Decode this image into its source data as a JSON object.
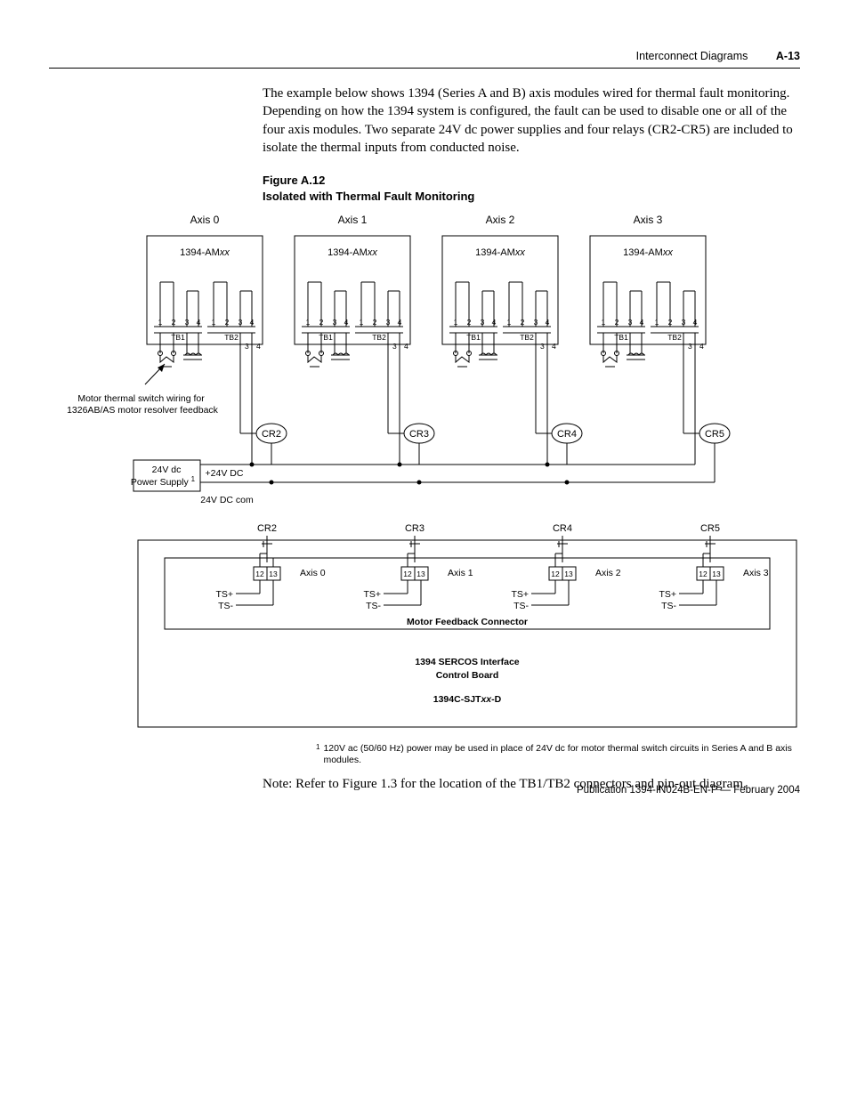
{
  "header": {
    "section": "Interconnect Diagrams",
    "pageno": "A-13"
  },
  "intro": "The example below shows 1394 (Series A and B) axis modules wired for thermal fault monitoring. Depending on how the 1394 system is configured, the fault can be used to disable one or all of the four axis modules. Two separate 24V dc power supplies and four relays (CR2-CR5) are included to isolate the thermal inputs from conducted noise.",
  "figure": {
    "num": "Figure A.12",
    "title": "Isolated with Thermal Fault Monitoring"
  },
  "diagram": {
    "axes": [
      {
        "label": "Axis 0",
        "module": "1394-AM",
        "mod_suffix": "xx",
        "relay_top": "CR2",
        "relay_bot": "CR2",
        "feedback_axis": "Axis 0"
      },
      {
        "label": "Axis 1",
        "module": "1394-AM",
        "mod_suffix": "xx",
        "relay_top": "CR3",
        "relay_bot": "CR3",
        "feedback_axis": "Axis 1"
      },
      {
        "label": "Axis 2",
        "module": "1394-AM",
        "mod_suffix": "xx",
        "relay_top": "CR4",
        "relay_bot": "CR4",
        "feedback_axis": "Axis 2"
      },
      {
        "label": "Axis 3",
        "module": "1394-AM",
        "mod_suffix": "xx",
        "relay_top": "CR5",
        "relay_bot": "CR5",
        "feedback_axis": "Axis 3"
      }
    ],
    "tb_labels": {
      "tb1": "TB1",
      "tb2": "TB2",
      "pins": [
        "1",
        "2",
        "3",
        "4"
      ]
    },
    "pins34": [
      "3",
      "4"
    ],
    "feedback_pins": [
      "12",
      "13"
    ],
    "ts_plus": "TS+",
    "ts_minus": "TS-",
    "thermal_note": "Motor thermal switch wiring for 1326AB/AS motor resolver feedback",
    "psu": {
      "line1": "24V dc",
      "line2": "Power Supply",
      "super": "1",
      "plus": "+24V DC",
      "com": "24V DC com"
    },
    "board": {
      "line1": "1394 SERCOS Interface",
      "line2": "Control Board",
      "model_prefix": "1394C-SJT",
      "model_mid": "xx",
      "model_suffix": "-D"
    },
    "mfc": "Motor Feedback Connector"
  },
  "footnote": {
    "sup": "1",
    "text": "120V ac (50/60 Hz) power may be used in place of 24V dc for motor thermal switch circuits in Series A and B axis modules."
  },
  "note": "Note: Refer to Figure 1.3 for the location of the TB1/TB2 connectors and pin-out diagram.",
  "pub": "Publication 1394-IN024B-EN-P — February 2004",
  "chart_data": {
    "type": "diagram",
    "description": "Wiring schematic: four 1394-AMxx axis modules (Axis 0–3) each with TB1/TB2 4-pin terminal blocks. Motor thermal switch on TB1 pins 1-2. Coil across TB1 pins 3-4. Relay coils CR2–CR5 powered from a 24V dc supply (+24V DC / 24V DC com). Relay contacts CR2–CR5 feed pins 12/13 (TS+/TS-) on Motor Feedback Connector of 1394 SERCOS Interface Control Board 1394C-SJTxx-D.",
    "axes": [
      "Axis 0",
      "Axis 1",
      "Axis 2",
      "Axis 3"
    ],
    "relays_coil": [
      "CR2",
      "CR3",
      "CR4",
      "CR5"
    ],
    "relays_contact": [
      "CR2",
      "CR3",
      "CR4",
      "CR5"
    ],
    "terminal_blocks": [
      "TB1",
      "TB2"
    ],
    "tb_pins": [
      1,
      2,
      3,
      4
    ],
    "feedback_pins": [
      12,
      13
    ],
    "feedback_signals": [
      "TS+",
      "TS-"
    ],
    "power_supply": "24V dc",
    "board_model": "1394C-SJTxx-D"
  }
}
